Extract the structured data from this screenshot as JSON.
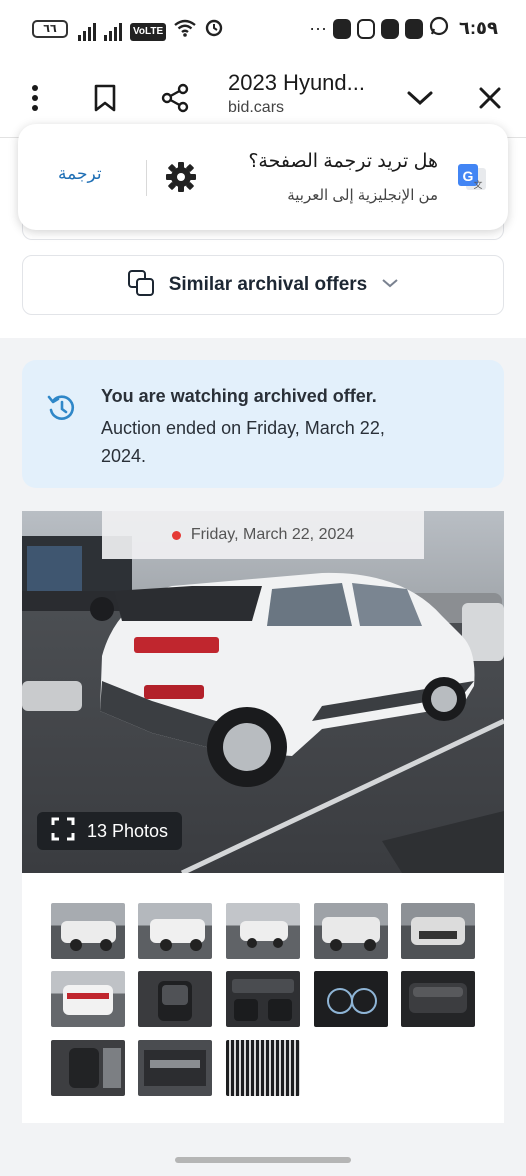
{
  "status_bar": {
    "battery": "٦٦",
    "volte": "VoLTE",
    "time": "٦:٥٩",
    "more": "···"
  },
  "toolbar": {
    "title": "2023 Hyund...",
    "url": "bid.cars"
  },
  "translate": {
    "action": "ترجمة",
    "question": "هل تريد ترجمة الصفحة؟",
    "languages": "من الإنجليزية إلى العربية"
  },
  "similar": {
    "label": "Similar archival offers"
  },
  "notice": {
    "title": "You are watching archived offer.",
    "body": "Auction ended on Friday, March 22, 2024."
  },
  "photo": {
    "date": "Friday, March 22, 2024",
    "count_label": "13 Photos"
  },
  "colors": {
    "accent_blue": "#1f6fb5",
    "notice_bg": "#e3f0fb",
    "status_dot": "#e53935"
  }
}
